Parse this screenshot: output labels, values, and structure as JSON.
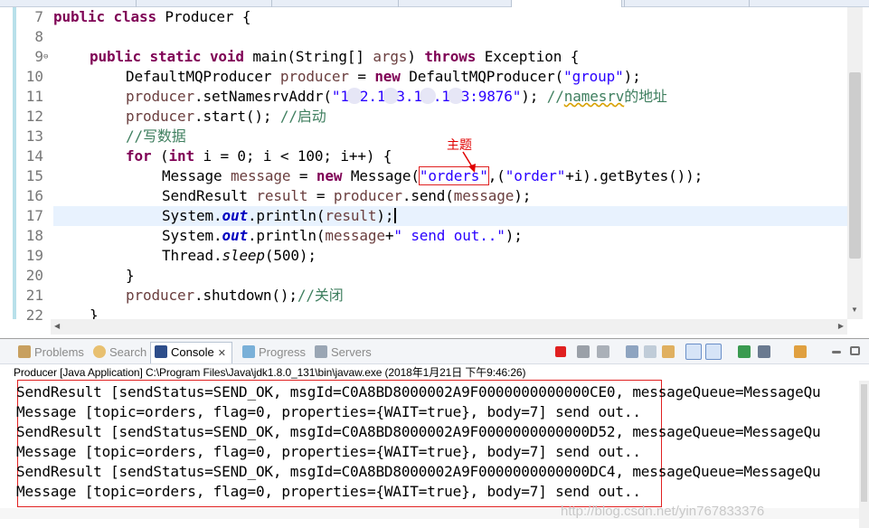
{
  "editor": {
    "line_numbers": [
      "7",
      "8",
      "9",
      "10",
      "11",
      "12",
      "13",
      "14",
      "15",
      "16",
      "17",
      "18",
      "19",
      "20",
      "21",
      "22"
    ],
    "fold_marker": "⊖",
    "code": {
      "l7": {
        "kw1": "public",
        "kw2": "class",
        "rest": " Producer {"
      },
      "l9": {
        "kw1": "public",
        "kw2": "static",
        "kw3": "void",
        "mid": " main(String[] ",
        "var": "args",
        "mid2": ") ",
        "kw4": "throws",
        "rest": " Exception {"
      },
      "l10": {
        "type": "DefaultMQProducer ",
        "var": "producer",
        "eq": " = ",
        "kw": "new",
        "call": " DefaultMQProducer(",
        "str": "\"group\"",
        "end": ");"
      },
      "l11": {
        "var": "producer",
        "call": ".setNamesrvAddr(",
        "str_a": "\"1",
        "str_b": "2.1",
        "str_c": "3.1",
        "str_d": ".1",
        "str_e": "3:9876\"",
        "end": "); ",
        "cmt_a": "//",
        "cmt_b": "namesrv",
        "cmt_c": "的地址"
      },
      "l12": {
        "var": "producer",
        "call": ".start(); ",
        "cmt": "//启动"
      },
      "l13": {
        "cmt": "//写数据"
      },
      "l14": {
        "kw": "for",
        "open": " (",
        "kw2": "int",
        "rest": " i = 0; i < 100; i++) {"
      },
      "l15": {
        "type": "Message ",
        "var": "message",
        "eq": " = ",
        "kw": "new",
        "call": " Message(",
        "str_q": "\"",
        "str_box": "orders\"",
        "mid": ",(",
        "str2": "\"order\"",
        "end": "+i).getBytes());"
      },
      "l16": {
        "type": "SendResult ",
        "var": "result",
        "eq": " = ",
        "var2": "producer",
        "call": ".send(",
        "var3": "message",
        "end": ");"
      },
      "l17": {
        "cls": "System.",
        "fld": "out",
        "call": ".println(",
        "var": "result",
        "end": ");"
      },
      "l18": {
        "cls": "System.",
        "fld": "out",
        "call": ".println(",
        "var": "message",
        "plus": "+",
        "str": "\" send out..\"",
        "end": ");"
      },
      "l19": {
        "cls": "Thread.",
        "mth": "sleep",
        "end": "(500);"
      },
      "l20": {
        "text": "}"
      },
      "l21": {
        "var": "producer",
        "call": ".shutdown();",
        "cmt": "//关闭"
      },
      "l22": {
        "text": "}"
      }
    },
    "annotation": "主题"
  },
  "console_view": {
    "tabs": [
      {
        "label": "Problems",
        "icon": "problems-icon"
      },
      {
        "label": "Search",
        "icon": "search-icon"
      },
      {
        "label": "Console",
        "icon": "console-icon",
        "close": "✕"
      },
      {
        "label": "Progress",
        "icon": "progress-icon"
      },
      {
        "label": "Servers",
        "icon": "servers-icon"
      }
    ],
    "toolbar_icons": [
      "terminate-icon",
      "remove-launch-icon",
      "remove-all-terminated-icon",
      "clear-console-icon",
      "scroll-lock-icon",
      "word-wrap-icon",
      "show-on-stdout-icon",
      "show-on-stderr-icon",
      "pin-console-icon",
      "display-selected-console-icon",
      "open-console-icon",
      "view-menu-icon",
      "minimize-icon",
      "maximize-icon"
    ],
    "process_title": "Producer [Java Application] C:\\Program Files\\Java\\jdk1.8.0_131\\bin\\javaw.exe (2018年1月21日 下午9:46:26)",
    "output_lines": [
      "SendResult [sendStatus=SEND_OK, msgId=C0A8BD8000002A9F0000000000000CE0, messageQueue=MessageQu",
      "Message [topic=orders, flag=0, properties={WAIT=true}, body=7] send out..",
      "SendResult [sendStatus=SEND_OK, msgId=C0A8BD8000002A9F0000000000000D52, messageQueue=MessageQu",
      "Message [topic=orders, flag=0, properties={WAIT=true}, body=7] send out..",
      "SendResult [sendStatus=SEND_OK, msgId=C0A8BD8000002A9F0000000000000DC4, messageQueue=MessageQu",
      "Message [topic=orders, flag=0, properties={WAIT=true}, body=7] send out.."
    ],
    "watermark": "http://blog.csdn.net/yin767833376"
  },
  "colors": {
    "keyword": "#7f0055",
    "string": "#2a00ff",
    "comment": "#3f7f5f",
    "field": "#0000c0",
    "annotation": "#e00000"
  }
}
